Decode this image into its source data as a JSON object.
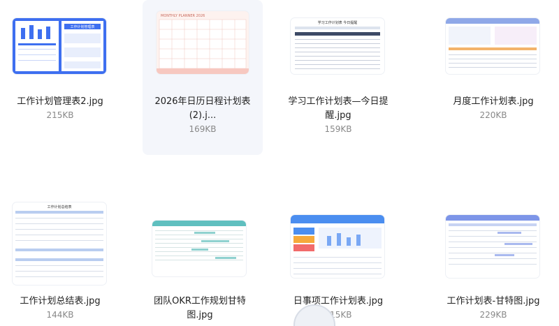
{
  "files": [
    {
      "name": "工作计划管理表2.jpg",
      "size": "215KB",
      "selected": false
    },
    {
      "name": "2026年日历日程计划表(2).j...",
      "size": "169KB",
      "selected": true
    },
    {
      "name": "学习工作计划表—今日提醒.jpg",
      "size": "159KB",
      "selected": false
    },
    {
      "name": "月度工作计划表.jpg",
      "size": "220KB",
      "selected": false
    },
    {
      "name": "工作计划总结表.jpg",
      "size": "144KB",
      "selected": false
    },
    {
      "name": "团队OKR工作规划甘特图.jpg",
      "size": "",
      "selected": false
    },
    {
      "name": "日事项工作计划表.jpg",
      "size": "215KB",
      "selected": false
    },
    {
      "name": "工作计划表-甘特图.jpg",
      "size": "229KB",
      "selected": false
    }
  ],
  "thumbnails": {
    "t1_title": "工作计划管理表",
    "t2_title": "MONTHLY PLANNER 2026",
    "t3_title": "学习工作计划表 今日提醒",
    "t5_title": "工作计划总结表"
  },
  "colors": {
    "blue": "#3e6ff0",
    "pink": "#f7c8c0",
    "teal": "#5fbfbf",
    "selected_bg": "#f4f6fb"
  }
}
